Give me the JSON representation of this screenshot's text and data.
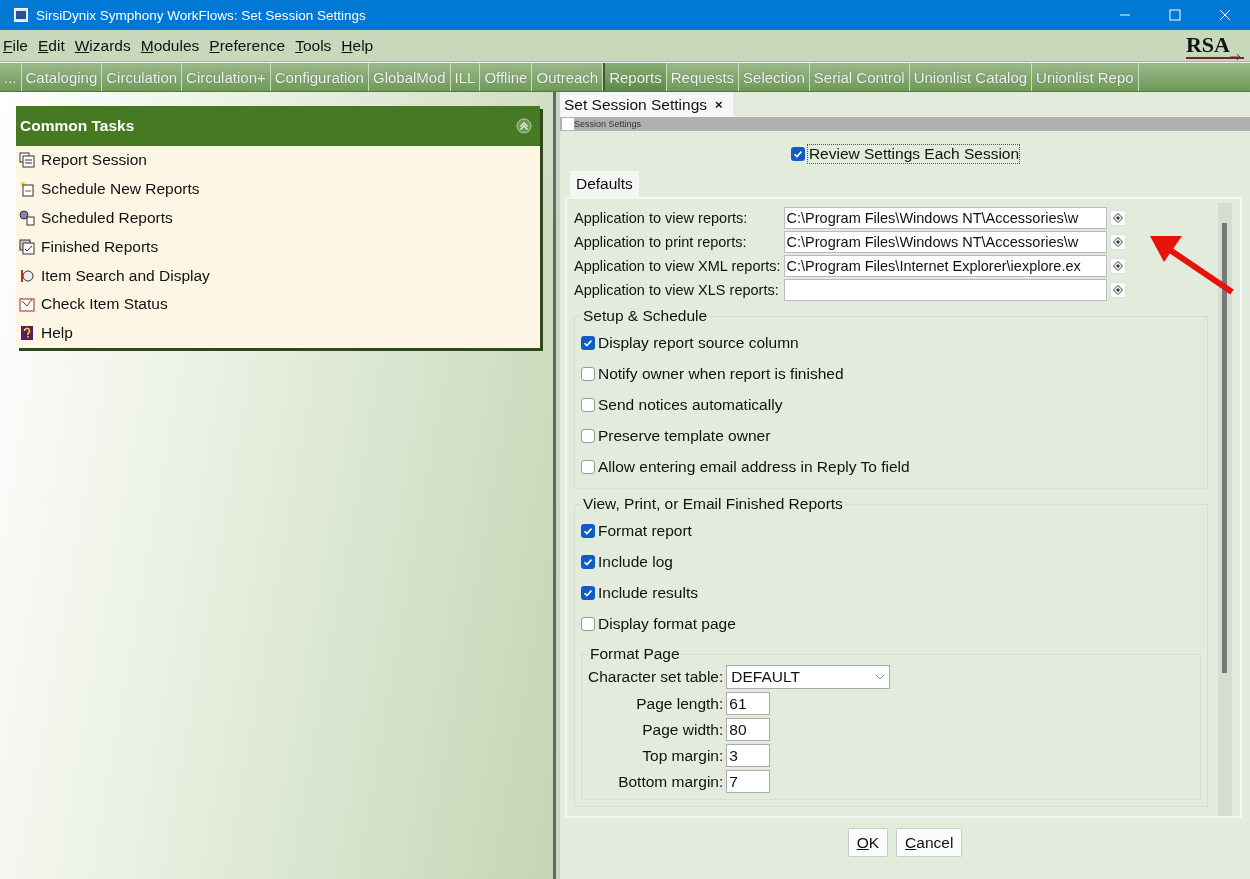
{
  "window": {
    "title": "SirsiDynix Symphony WorkFlows: Set Session Settings"
  },
  "menu": [
    "File",
    "Edit",
    "Wizards",
    "Modules",
    "Preference",
    "Tools",
    "Help"
  ],
  "logo": {
    "text": "RSA"
  },
  "modules": [
    {
      "label": "...",
      "selected": false
    },
    {
      "label": "Cataloging",
      "selected": false
    },
    {
      "label": "Circulation",
      "selected": false
    },
    {
      "label": "Circulation+",
      "selected": false
    },
    {
      "label": "Configuration",
      "selected": false
    },
    {
      "label": "GlobalMod",
      "selected": false
    },
    {
      "label": "ILL",
      "selected": false
    },
    {
      "label": "Offline",
      "selected": false
    },
    {
      "label": "Outreach",
      "selected": false
    },
    {
      "label": "Reports",
      "selected": true
    },
    {
      "label": "Requests",
      "selected": false
    },
    {
      "label": "Selection",
      "selected": false
    },
    {
      "label": "Serial Control",
      "selected": false
    },
    {
      "label": "Unionlist Catalog",
      "selected": false
    },
    {
      "label": "Unionlist Repo",
      "selected": false
    }
  ],
  "common_tasks": {
    "title": "Common Tasks",
    "items": [
      {
        "label": "Report Session",
        "kind": "session"
      },
      {
        "label": "Schedule New Reports",
        "kind": "schedule"
      },
      {
        "label": "Scheduled Reports",
        "kind": "scheduled"
      },
      {
        "label": "Finished Reports",
        "kind": "finished"
      },
      {
        "label": "Item Search and Display",
        "kind": "search"
      },
      {
        "label": "Check Item Status",
        "kind": "status"
      },
      {
        "label": "Help",
        "kind": "help"
      }
    ]
  },
  "document_tab": {
    "label": "Set Session Settings",
    "close": "×"
  },
  "breadcrumb": "Session Settings",
  "review_each_session": {
    "label": "Review Settings Each Session",
    "checked": true
  },
  "inner_tab": "Defaults",
  "applications": [
    {
      "label": "Application to view reports:",
      "value": "C:\\Program Files\\Windows NT\\Accessories\\w"
    },
    {
      "label": "Application to print reports:",
      "value": "C:\\Program Files\\Windows NT\\Accessories\\w"
    },
    {
      "label": "Application to view XML reports:",
      "value": "C:\\Program Files\\Internet Explorer\\iexplore.ex"
    },
    {
      "label": "Application to view XLS reports:"
    }
  ],
  "setup_schedule": {
    "title": "Setup & Schedule",
    "options": [
      {
        "label": "Display report source column",
        "checked": true
      },
      {
        "label": "Notify owner when report is finished",
        "checked": false
      },
      {
        "label": "Send notices automatically",
        "checked": false
      },
      {
        "label": "Preserve template owner",
        "checked": false
      },
      {
        "label": "Allow entering email address in Reply To field",
        "checked": false
      }
    ]
  },
  "finished_reports": {
    "title": "View, Print, or Email Finished Reports",
    "options": [
      {
        "label": "Format report",
        "checked": true
      },
      {
        "label": "Include log",
        "checked": true
      },
      {
        "label": "Include results",
        "checked": true
      },
      {
        "label": "Display format page",
        "checked": false
      }
    ],
    "format_page": {
      "title": "Format Page",
      "charset": {
        "label": "Character set table:",
        "value": "DEFAULT"
      },
      "fields": [
        {
          "label": "Page length:",
          "value": "61"
        },
        {
          "label": "Page width:",
          "value": "80"
        },
        {
          "label": "Top margin:",
          "value": "3"
        },
        {
          "label": "Bottom margin:",
          "value": "7"
        }
      ]
    }
  },
  "buttons": [
    "OK",
    "Cancel"
  ]
}
